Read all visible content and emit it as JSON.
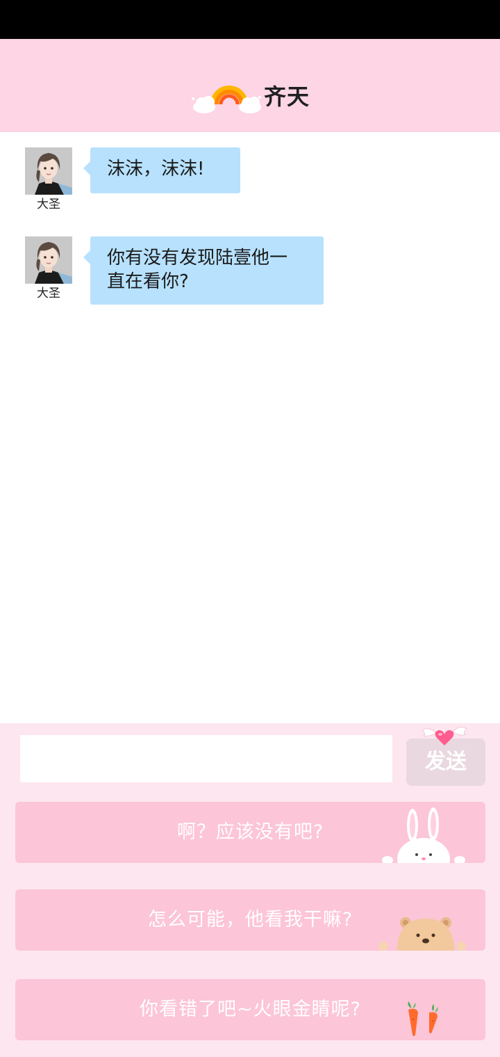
{
  "header": {
    "title": "齐天",
    "icon": "rainbow-cloud-icon"
  },
  "messages": [
    {
      "sender": "大圣",
      "text": "沫沫，沫沫!"
    },
    {
      "sender": "大圣",
      "text": "你有没有发现陆壹他一\n直在看你?"
    }
  ],
  "composer": {
    "input_value": "",
    "send_label": "发送"
  },
  "options": [
    {
      "label": "啊？应该没有吧?",
      "decoration": "rabbit-icon"
    },
    {
      "label": "怎么可能，他看我干嘛?",
      "decoration": "bear-icon"
    },
    {
      "label": "你看错了吧~火眼金睛呢?",
      "decoration": "carrot-icon"
    }
  ],
  "colors": {
    "header_bg": "#fdd5e5",
    "bubble_bg": "#b7e1fd",
    "panel_bg": "#fde6ef",
    "option_bg": "#fcc5d8",
    "send_bg": "#e9d8df"
  }
}
